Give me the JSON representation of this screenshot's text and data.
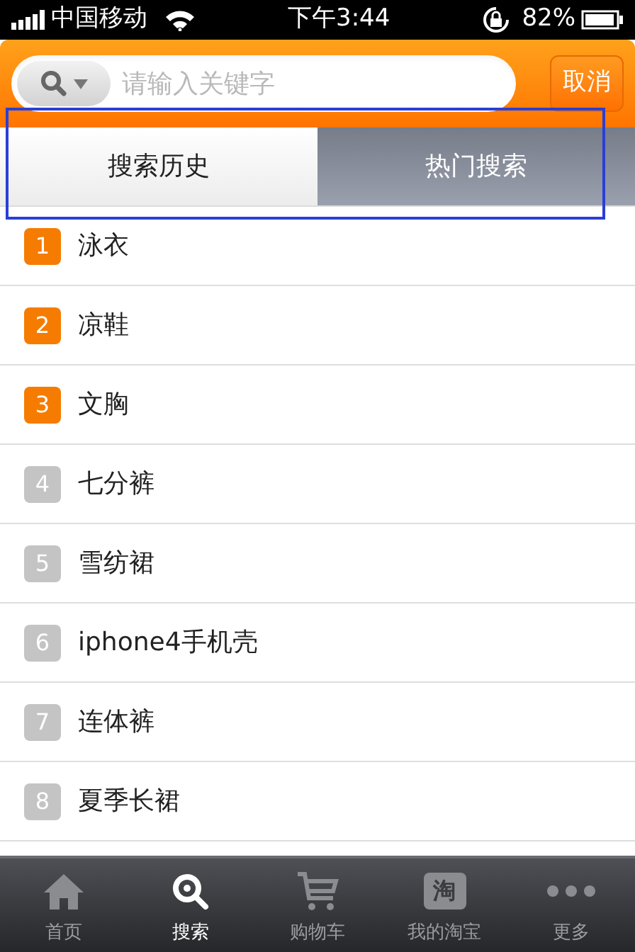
{
  "status_bar": {
    "carrier": "中国移动",
    "time": "下午3:44",
    "battery": "82%"
  },
  "search": {
    "placeholder": "请输入关键字",
    "cancel": "取消"
  },
  "tabs": [
    {
      "label": "搜索历史",
      "selected": true
    },
    {
      "label": "热门搜索",
      "selected": false
    }
  ],
  "results": [
    {
      "rank": "1",
      "text": "泳衣",
      "color": "#f57c00"
    },
    {
      "rank": "2",
      "text": "凉鞋",
      "color": "#f57c00"
    },
    {
      "rank": "3",
      "text": "文胸",
      "color": "#f57c00"
    },
    {
      "rank": "4",
      "text": "七分裤",
      "color": "#c4c4c4"
    },
    {
      "rank": "5",
      "text": "雪纺裙",
      "color": "#c4c4c4"
    },
    {
      "rank": "6",
      "text": "iphone4手机壳",
      "color": "#c4c4c4"
    },
    {
      "rank": "7",
      "text": "连体裤",
      "color": "#c4c4c4"
    },
    {
      "rank": "8",
      "text": "夏季长裙",
      "color": "#c4c4c4"
    }
  ],
  "tab_bar": [
    {
      "kind": "home",
      "label": "首页",
      "selected": false
    },
    {
      "kind": "search",
      "label": "搜索",
      "selected": true
    },
    {
      "kind": "cart",
      "label": "购物车",
      "selected": false
    },
    {
      "kind": "taobao",
      "glyph": "淘",
      "label": "我的淘宝",
      "selected": false
    },
    {
      "kind": "more",
      "label": "更多",
      "selected": false
    }
  ]
}
